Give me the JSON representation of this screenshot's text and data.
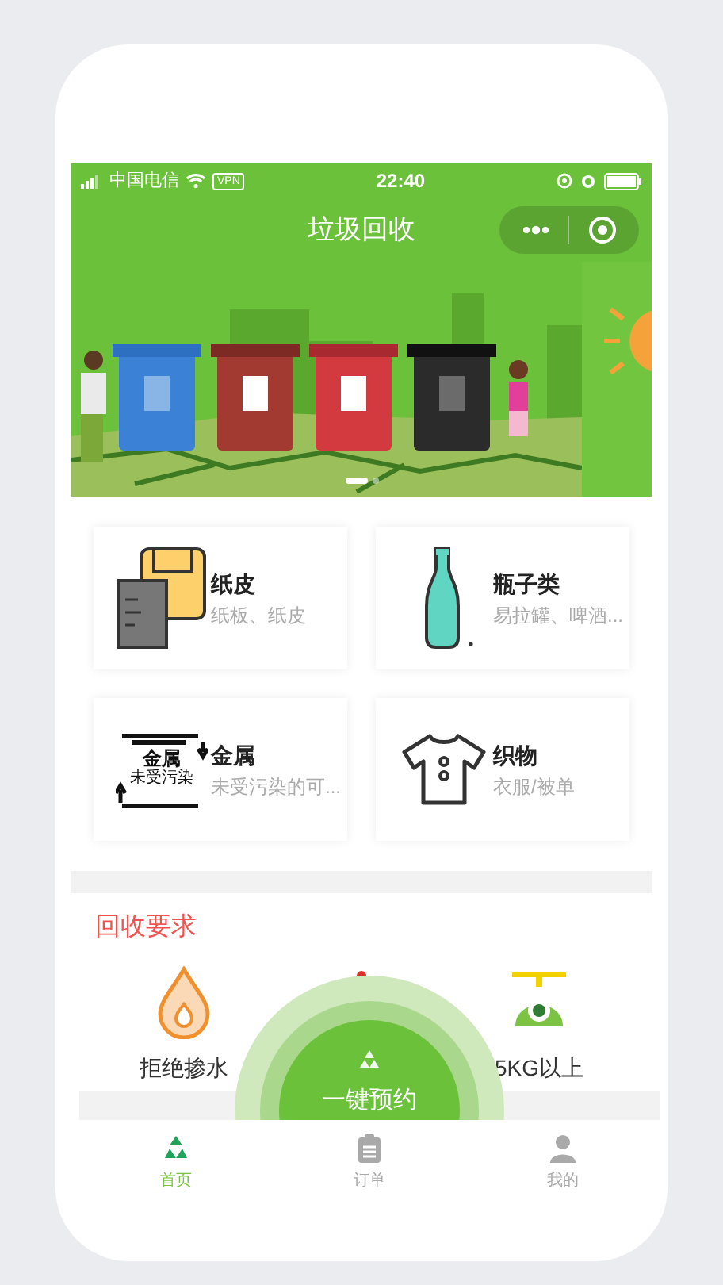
{
  "status_bar": {
    "carrier": "中国电信",
    "vpn": "VPN",
    "time": "22:40"
  },
  "nav_bar": {
    "title": "垃圾回收"
  },
  "banner": {
    "pages": [
      {
        "selected": true
      },
      {
        "selected": false
      }
    ]
  },
  "categories": [
    {
      "kind": "paper",
      "title": "纸皮",
      "subtitle": "纸板、纸皮"
    },
    {
      "kind": "bottle",
      "title": "瓶子类",
      "subtitle": "易拉罐、啤酒..."
    },
    {
      "kind": "metal",
      "title": "金属",
      "subtitle": "未受污染的可...",
      "icon_text": "金属",
      "icon_subtext": "未受污染"
    },
    {
      "kind": "cloth",
      "title": "织物",
      "subtitle": "衣服/被单"
    }
  ],
  "requirements": {
    "title": "回收要求",
    "items": [
      {
        "kind": "water",
        "label": "拒绝掺水"
      },
      {
        "kind": "clean"
      },
      {
        "kind": "weight",
        "label": "5KG以上"
      }
    ]
  },
  "book_button": {
    "label": "一键预约"
  },
  "tab_bar": [
    {
      "kind": "home",
      "label": "首页",
      "selected": true
    },
    {
      "kind": "orders",
      "label": "订单",
      "selected": false
    },
    {
      "kind": "me",
      "label": "我的",
      "selected": false
    }
  ]
}
